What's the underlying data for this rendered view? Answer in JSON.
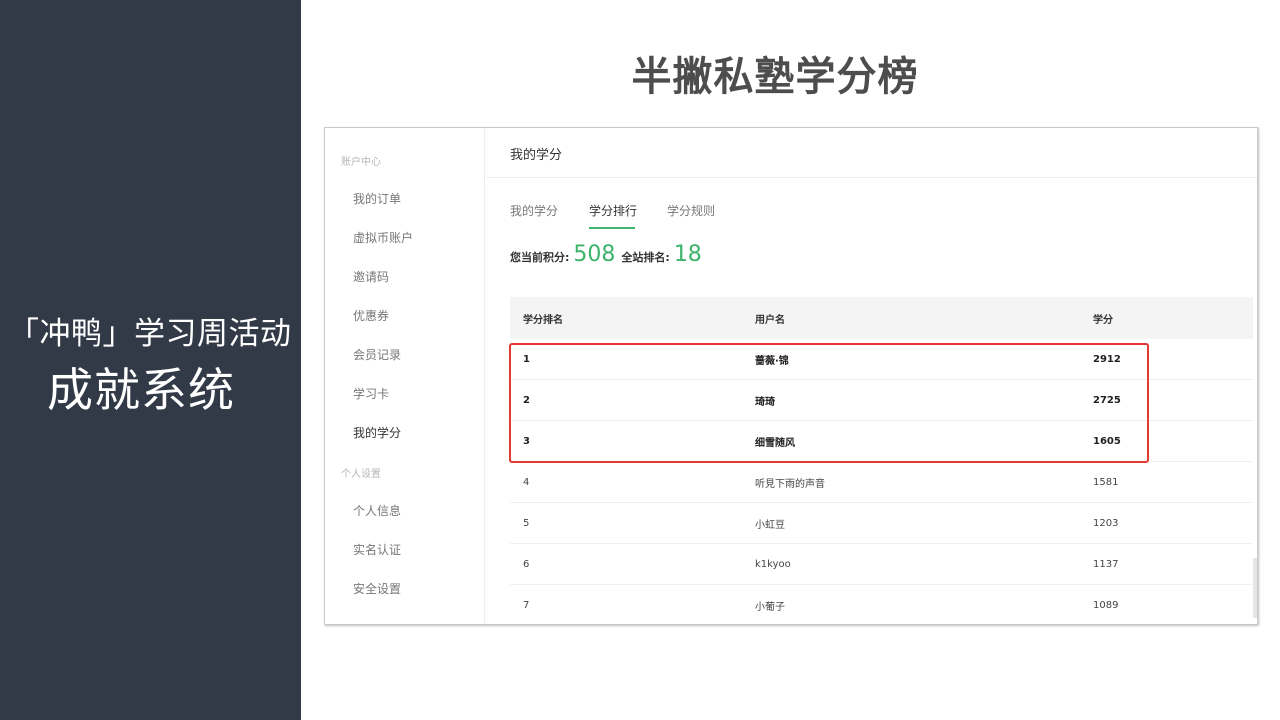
{
  "slide": {
    "title": "半撇私塾学分榜",
    "left_line1": "「冲鸭」学习周活动",
    "left_line2": "成就系统"
  },
  "sidebar": {
    "group_account": "账户中心",
    "account_items": [
      {
        "label": "我的订单"
      },
      {
        "label": "虚拟币账户"
      },
      {
        "label": "邀请码"
      },
      {
        "label": "优惠券"
      },
      {
        "label": "会员记录"
      },
      {
        "label": "学习卡"
      },
      {
        "label": "我的学分"
      }
    ],
    "group_personal": "个人设置",
    "personal_items": [
      {
        "label": "个人信息"
      },
      {
        "label": "实名认证"
      },
      {
        "label": "安全设置"
      }
    ]
  },
  "main": {
    "header_title": "我的学分",
    "tabs": [
      {
        "label": "我的学分"
      },
      {
        "label": "学分排行"
      },
      {
        "label": "学分规则"
      }
    ],
    "active_tab": "学分排行",
    "current_points_label": "您当前积分:",
    "current_points": "508",
    "site_rank_label": "全站排名:",
    "site_rank": "18"
  },
  "table": {
    "headers": [
      "学分排名",
      "用户名",
      "学分"
    ],
    "rows": [
      {
        "rank": "1",
        "user": "蔷薇·锦",
        "score": "2912"
      },
      {
        "rank": "2",
        "user": "琦琦",
        "score": "2725"
      },
      {
        "rank": "3",
        "user": "细雪随风",
        "score": "1605"
      },
      {
        "rank": "4",
        "user": "听見下雨的声音",
        "score": "1581"
      },
      {
        "rank": "5",
        "user": "小虹豆",
        "score": "1203"
      },
      {
        "rank": "6",
        "user": "k1kyoo",
        "score": "1137"
      },
      {
        "rank": "7",
        "user": "小葡子",
        "score": "1089"
      }
    ]
  },
  "colors": {
    "left_panel": "#333a47",
    "accent_green": "#3bb36a",
    "highlight_red": "#e43a31"
  }
}
